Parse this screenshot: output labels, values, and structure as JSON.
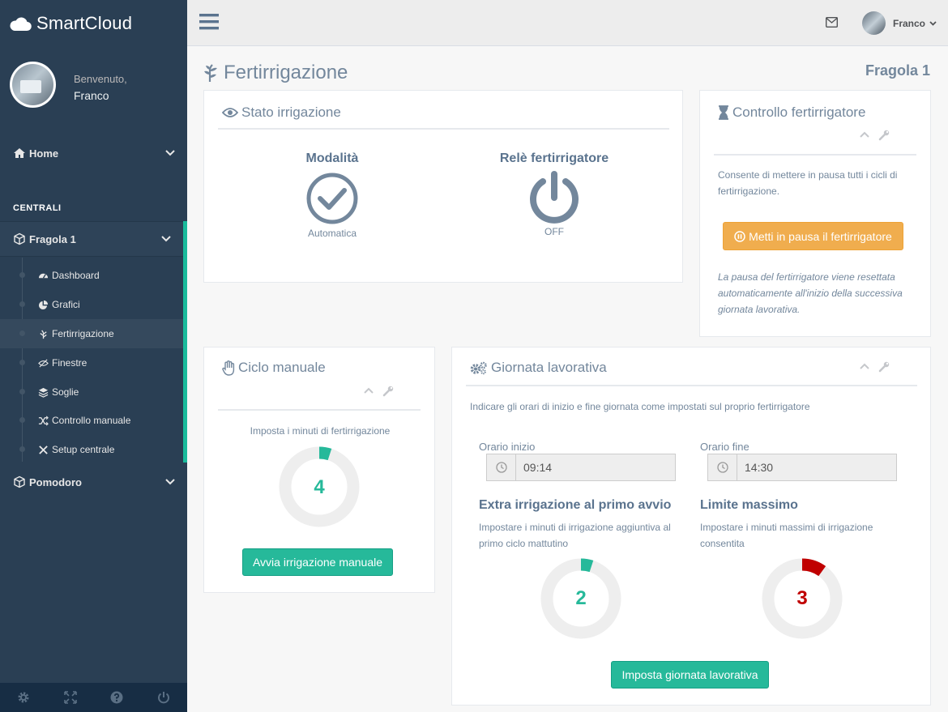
{
  "brand": {
    "name": "SmartCloud"
  },
  "profile": {
    "welcome": "Benvenuto,",
    "name": "Franco"
  },
  "sidebar": {
    "home": "Home",
    "section": "CENTRALI",
    "group1": "Fragola 1",
    "items": [
      "Dashboard",
      "Grafici",
      "Fertirrigazione",
      "Finestre",
      "Soglie",
      "Controllo manuale",
      "Setup centrale"
    ],
    "group2": "Pomodoro"
  },
  "topnav": {
    "user": "Franco"
  },
  "page": {
    "title": "Fertirrigazione",
    "station": "Fragola 1"
  },
  "stato": {
    "title": "Stato irrigazione",
    "mode_label": "Modalità",
    "mode_value": "Automatica",
    "relay_label": "Relè fertirrigatore",
    "relay_value": "OFF"
  },
  "controllo": {
    "title": "Controllo fertirrigatore",
    "desc": "Consente di mettere in pausa tutti i cicli di fertirrigazione.",
    "button": "Metti in pausa il fertirrigatore",
    "note": "La pausa del fertirrigatore viene resettata automaticamente all'inizio della successiva giornata lavorativa."
  },
  "ciclo": {
    "title": "Ciclo manuale",
    "desc": "Imposta i minuti di fertirrigazione",
    "value": "4",
    "fraction": 0.05,
    "button": "Avvia irrigazione manuale"
  },
  "giornata": {
    "title": "Giornata lavorativa",
    "desc": "Indicare gli orari di inizio e fine giornata come impostati sul proprio fertirrigatore",
    "start_label": "Orario inizio",
    "start_value": "09:14",
    "end_label": "Orario fine",
    "end_value": "14:30",
    "extra_title": "Extra irrigazione al primo avvio",
    "extra_desc": "Impostare i minuti di irrigazione aggiuntiva al primo ciclo mattutino",
    "extra_value": "2",
    "extra_fraction": 0.05,
    "limit_title": "Limite massimo",
    "limit_desc": "Impostare i minuti massimi di irrigazione consentita",
    "limit_value": "3",
    "limit_fraction": 0.1,
    "button": "Imposta giornata lavorativa"
  },
  "colors": {
    "accent": "#1abb9c",
    "sidebar": "#2a3f54",
    "warning": "#f0ad4e",
    "danger": "#c00000"
  }
}
